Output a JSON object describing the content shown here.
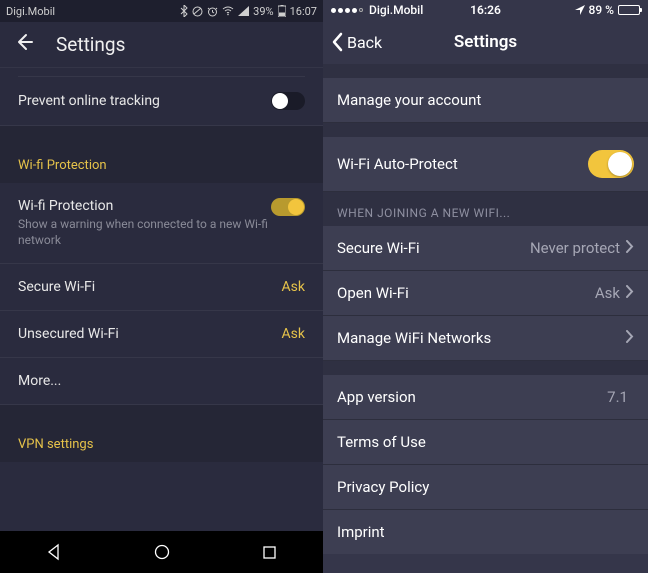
{
  "left": {
    "status": {
      "carrier": "Digi.Mobil",
      "battery_pct": "39%",
      "time": "16:07"
    },
    "header": {
      "title": "Settings"
    },
    "tracking_row": {
      "label": "Prevent online tracking",
      "on": false
    },
    "wifi_section_title": "Wi-fi Protection",
    "wifi_protection_row": {
      "label": "Wi-fi Protection",
      "sub": "Show a warning when connected to a new Wi-fi network",
      "on": true
    },
    "secure_wifi": {
      "label": "Secure Wi-Fi",
      "value": "Ask"
    },
    "unsecured_wifi": {
      "label": "Unsecured Wi-Fi",
      "value": "Ask"
    },
    "more": {
      "label": "More..."
    },
    "vpn_section_title": "VPN settings"
  },
  "right": {
    "status": {
      "carrier": "Digi.Mobil",
      "time": "16:26",
      "battery_pct": "89 %"
    },
    "header": {
      "back": "Back",
      "title": "Settings"
    },
    "manage_account": {
      "label": "Manage your account"
    },
    "wifi_autoprotect": {
      "label": "Wi-Fi Auto-Protect",
      "on": true
    },
    "joining_header": "WHEN JOINING A NEW WIFI...",
    "secure_wifi": {
      "label": "Secure Wi-Fi",
      "value": "Never protect"
    },
    "open_wifi": {
      "label": "Open Wi-Fi",
      "value": "Ask"
    },
    "manage_networks": {
      "label": "Manage WiFi Networks"
    },
    "app_version": {
      "label": "App version",
      "value": "7.1"
    },
    "terms": {
      "label": "Terms of Use"
    },
    "privacy": {
      "label": "Privacy Policy"
    },
    "imprint": {
      "label": "Imprint"
    }
  }
}
